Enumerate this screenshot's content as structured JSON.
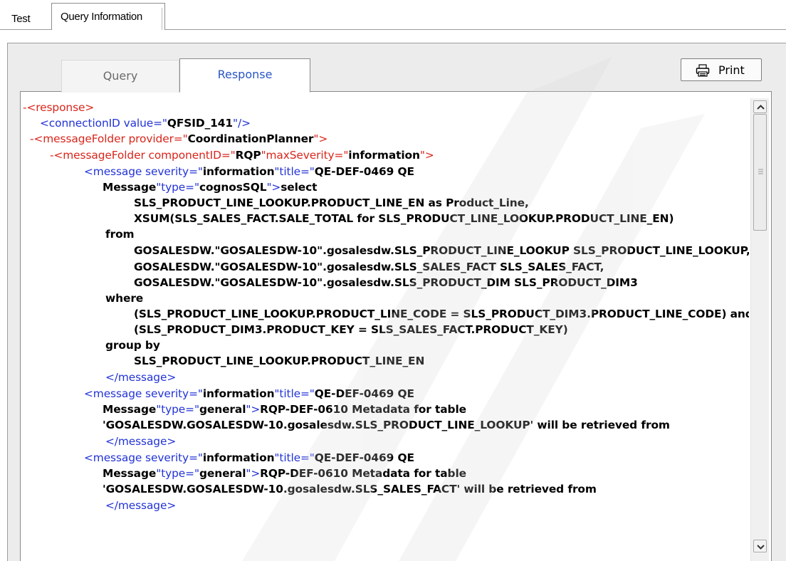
{
  "top_tabs": [
    "Test",
    "Query Information"
  ],
  "sub_tabs": {
    "query": "Query",
    "response": "Response",
    "active": "Response"
  },
  "print_button": {
    "label": "Print",
    "icon": "printer-icon"
  },
  "colors": {
    "markup": "#d9261c",
    "text": "#2233d6",
    "value": "#000000",
    "active_tab": "#2a55c6"
  },
  "xml": {
    "response_open": "-<response>",
    "connection": {
      "prefix": "<connectionID value=\"",
      "value": "QFSID_141",
      "suffix": "\"/>"
    },
    "folder1": {
      "collapse": "-",
      "prefix": "<messageFolder provider=\"",
      "value": "CoordinationPlanner",
      "suffix": "\">"
    },
    "folder2": {
      "collapse": "-",
      "p1": "<messageFolder componentID=\"",
      "v1": "RQP",
      "p2": "\"maxSeverity=\"",
      "v2": "information",
      "p3": "\">"
    },
    "msg1": {
      "open": "<message severity=\"",
      "severity": "information",
      "title_attr": "\"title=\"",
      "title": "QE-DEF-0469 QE",
      "title_cont": "Message",
      "type_attr": "\"type=\"",
      "type": "cognosSQL",
      "close_bracket": "\">",
      "sql_first": "select",
      "sql": [
        "SLS_PRODUCT_LINE_LOOKUP.PRODUCT_LINE_EN  as  Product_Line,",
        "XSUM(SLS_SALES_FACT.SALE_TOTAL  for SLS_PRODUCT_LINE_LOOKUP.PRODUCT_LINE_EN)",
        "from",
        "GOSALESDW.\"GOSALESDW-10\".gosalesdw.SLS_PRODUCT_LINE_LOOKUP SLS_PRODUCT_LINE_LOOKUP,",
        "GOSALESDW.\"GOSALESDW-10\".gosalesdw.SLS_SALES_FACT SLS_SALES_FACT,",
        "GOSALESDW.\"GOSALESDW-10\".gosalesdw.SLS_PRODUCT_DIM SLS_PRODUCT_DIM3",
        "where",
        "(SLS_PRODUCT_LINE_LOOKUP.PRODUCT_LINE_CODE = SLS_PRODUCT_DIM3.PRODUCT_LINE_CODE) and",
        "(SLS_PRODUCT_DIM3.PRODUCT_KEY = SLS_SALES_FACT.PRODUCT_KEY)",
        "group by",
        "SLS_PRODUCT_LINE_LOOKUP.PRODUCT_LINE_EN"
      ],
      "close": "</message>"
    },
    "msg2": {
      "open": "<message severity=\"",
      "severity": "information",
      "title_attr": "\"title=\"",
      "title": "QE-DEF-0469 QE",
      "title_cont": "Message",
      "type_attr": "\"type=\"",
      "type": "general",
      "close_bracket": "\">",
      "text1": "RQP-DEF-0610 Metadata for table",
      "text2": "'GOSALESDW.GOSALESDW-10.gosalesdw.SLS_PRODUCT_LINE_LOOKUP' will be retrieved from",
      "close": "</message>"
    },
    "msg3": {
      "open": "<message severity=\"",
      "severity": "information",
      "title_attr": "\"title=\"",
      "title": "QE-DEF-0469 QE",
      "title_cont": "Message",
      "type_attr": "\"type=\"",
      "type": "general",
      "close_bracket": "\">",
      "text1": "RQP-DEF-0610 Metadata for table",
      "text2": "'GOSALESDW.GOSALESDW-10.gosalesdw.SLS_SALES_FACT' will be retrieved from",
      "close": "</message>"
    }
  }
}
